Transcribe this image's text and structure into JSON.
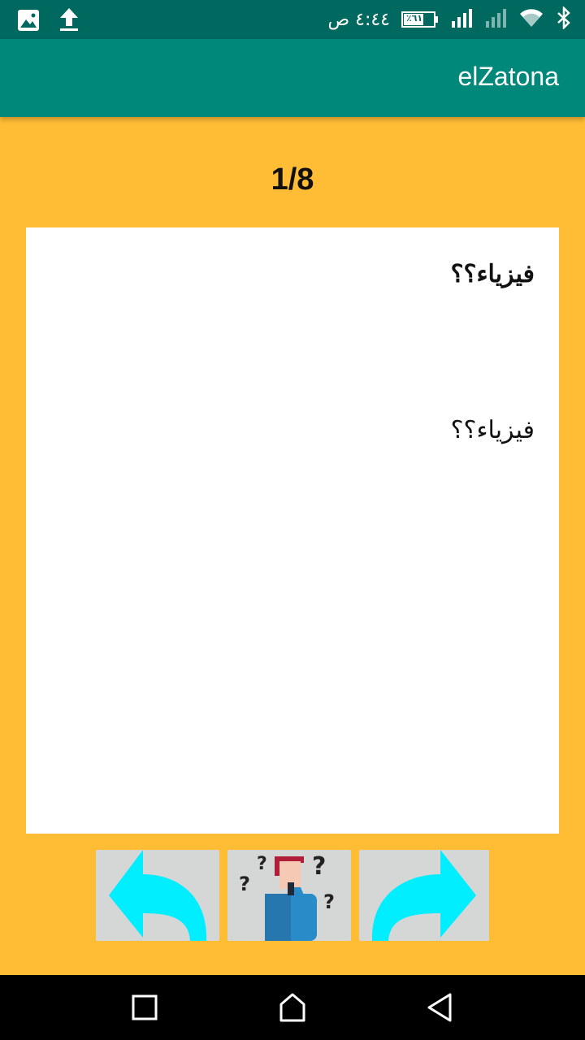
{
  "status_bar": {
    "time": "٤:٤٤ ص",
    "battery_label": "٪٦١",
    "icons": [
      "image-icon",
      "upload-icon",
      "bluetooth-icon",
      "wifi-icon",
      "signal-weak-icon",
      "signal-icon",
      "battery-icon"
    ]
  },
  "app_bar": {
    "title": "elZatona"
  },
  "quiz": {
    "counter": "1/8",
    "question": "فيزياء؟؟",
    "answer": "فيزياء؟؟"
  },
  "buttons": {
    "prev_icon": "arrow-back-icon",
    "hint_icon": "thinking-person-icon",
    "next_icon": "arrow-forward-icon"
  },
  "colors": {
    "background": "#FFBC35",
    "app_bar": "#00897B",
    "status_bar": "#00695F",
    "button": "#D5D6D6",
    "arrow": "#00EEFF"
  }
}
